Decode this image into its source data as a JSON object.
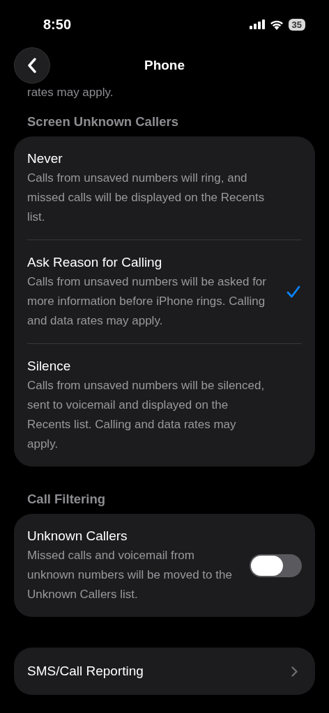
{
  "status_bar": {
    "time": "8:50",
    "battery": "35"
  },
  "nav": {
    "title": "Phone"
  },
  "intro_tail": "rates may apply.",
  "screen_unknown": {
    "header": "Screen Unknown Callers",
    "options": [
      {
        "title": "Never",
        "description": "Calls from unsaved numbers will ring, and missed calls will be displayed on the Recents list.",
        "selected": false
      },
      {
        "title": "Ask Reason for Calling",
        "description": "Calls from unsaved numbers will be asked for more information before iPhone rings. Calling and data rates may apply.",
        "selected": true
      },
      {
        "title": "Silence",
        "description": "Calls from unsaved numbers will be silenced, sent to voicemail and displayed on the Recents list. Calling and data rates may apply.",
        "selected": false
      }
    ]
  },
  "call_filtering": {
    "header": "Call Filtering",
    "title": "Unknown Callers",
    "description": "Missed calls and voicemail from unknown numbers will be moved to the Unknown Callers list.",
    "on": false
  },
  "sms_row": {
    "title": "SMS/Call Reporting"
  }
}
